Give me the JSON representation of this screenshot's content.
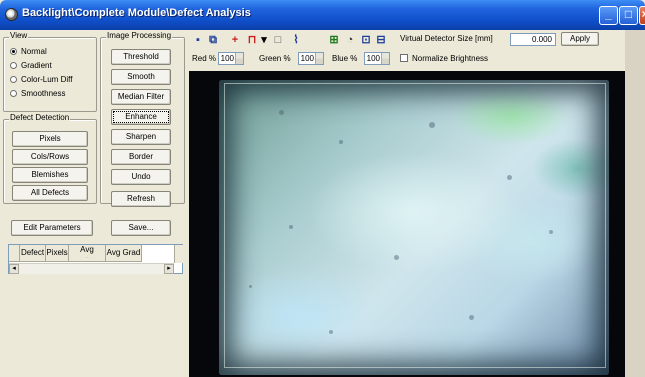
{
  "window": {
    "title": "Backlight\\Complete Module\\Defect Analysis",
    "controls": {
      "minimize": "_",
      "maximize": "□",
      "close": "×"
    }
  },
  "view_group": {
    "title": "View",
    "options": [
      {
        "label": "Normal",
        "selected": true
      },
      {
        "label": "Gradient",
        "selected": false
      },
      {
        "label": "Color-Lum Diff",
        "selected": false
      },
      {
        "label": "Smoothness",
        "selected": false
      }
    ]
  },
  "defect_group": {
    "title": "Defect Detection",
    "buttons": [
      "Pixels",
      "Cols/Rows",
      "Blemishes",
      "All Defects"
    ]
  },
  "image_processing_group": {
    "title": "Image Processing",
    "buttons": [
      "Threshold",
      "Smooth",
      "Median Filter",
      "Enhance",
      "Sharpen",
      "Border",
      "Undo"
    ],
    "focused": "Enhance",
    "refresh": "Refresh"
  },
  "actions": {
    "edit_parameters": "Edit Parameters",
    "save": "Save..."
  },
  "defect_table": {
    "columns": [
      "Defect",
      "Pixels",
      "Avg",
      "Avg Grad"
    ],
    "avg_sub": "...",
    "scroll_left": "◂",
    "scroll_right": "▸"
  },
  "toolbar": {
    "icons": [
      {
        "name": "save-icon",
        "glyph": "▪",
        "color": "#1d3f9a"
      },
      {
        "name": "copy-icon",
        "glyph": "⧉",
        "color": "#1d3f9a"
      },
      {
        "name": "crosshair-icon",
        "glyph": "+",
        "color": "#c81e1e"
      },
      {
        "name": "roi-icon",
        "glyph": "⊓",
        "color": "#c81e1e"
      },
      {
        "name": "dropdown-icon",
        "glyph": "▾",
        "color": "#000000"
      },
      {
        "name": "rectangle-icon",
        "glyph": "□",
        "color": "#555555"
      },
      {
        "name": "line-profile-icon",
        "glyph": "⌇",
        "color": "#1d3f9a"
      },
      {
        "name": "histogram-icon",
        "glyph": "⊞",
        "color": "#1d7a1d"
      },
      {
        "name": "overlay-icon",
        "glyph": "◔",
        "color": "#333333"
      },
      {
        "name": "zoom-icon",
        "glyph": "⊡",
        "color": "#1d3f9a"
      },
      {
        "name": "export-icon",
        "glyph": "⊟",
        "color": "#1d3f9a"
      }
    ],
    "virtual_detector_label": "Virtual Detector Size [mm]",
    "virtual_detector_value": "0.000",
    "apply": "Apply",
    "red_label": "Red %",
    "red_value": "100",
    "green_label": "Green %",
    "green_value": "100",
    "blue_label": "Blue %",
    "blue_value": "100",
    "normalize_label": "Normalize Brightness",
    "normalize_checked": false
  }
}
